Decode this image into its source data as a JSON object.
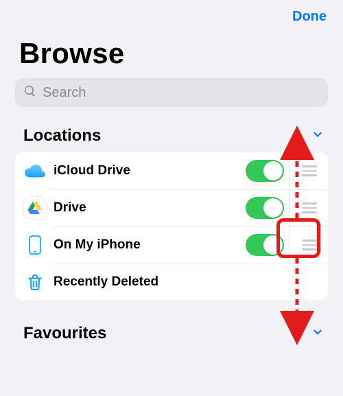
{
  "header": {
    "done_label": "Done",
    "title": "Browse"
  },
  "search": {
    "placeholder": "Search"
  },
  "sections": {
    "locations": {
      "title": "Locations",
      "items": [
        {
          "label": "iCloud Drive",
          "toggle": true,
          "has_toggle": true,
          "has_handle": true,
          "icon": "cloud"
        },
        {
          "label": "Drive",
          "toggle": true,
          "has_toggle": true,
          "has_handle": true,
          "icon": "gdrive"
        },
        {
          "label": "On My iPhone",
          "toggle": true,
          "has_toggle": true,
          "has_handle": true,
          "icon": "iphone"
        },
        {
          "label": "Recently Deleted",
          "toggle": false,
          "has_toggle": false,
          "has_handle": false,
          "icon": "trash"
        }
      ]
    },
    "favourites": {
      "title": "Favourites"
    }
  },
  "colors": {
    "accent": "#007aff",
    "toggle_on": "#34c759",
    "annotation": "#e21b1b"
  },
  "annotation": {
    "highlighted_row_index": 1,
    "description": "drag-handle-highlight"
  }
}
